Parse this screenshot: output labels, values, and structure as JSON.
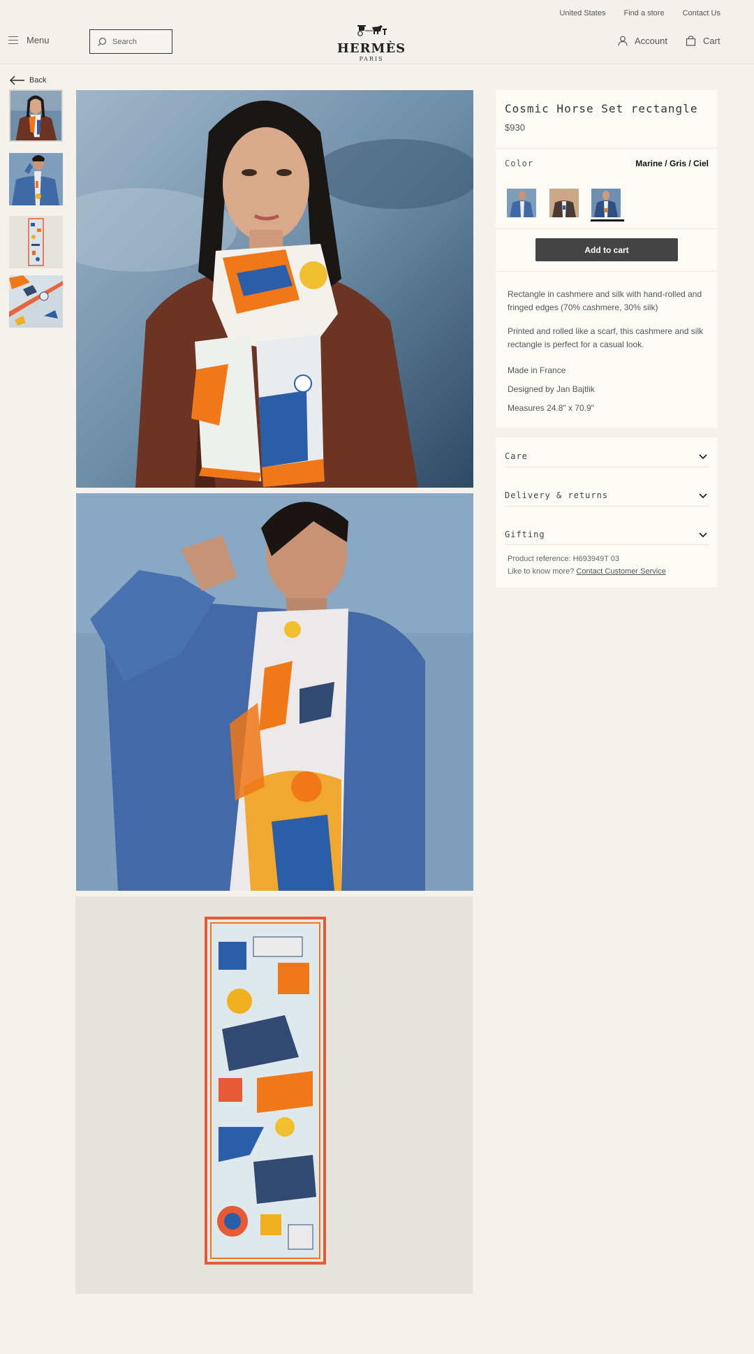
{
  "header": {
    "util_links": [
      "United States",
      "Find a store",
      "Contact Us"
    ],
    "menu_label": "Menu",
    "search_placeholder": "Search",
    "logo": {
      "brand": "HERMÈS",
      "city": "PARIS"
    },
    "account_label": "Account",
    "cart_label": "Cart"
  },
  "back_label": "Back",
  "gallery": {
    "thumbnails": [
      "model-woman-brown-jacket",
      "model-man-denim-shirt",
      "scarf-flat-lay",
      "scarf-detail"
    ],
    "images": [
      "woman-wearing-scarf",
      "man-wearing-scarf",
      "scarf-laid-flat"
    ]
  },
  "product": {
    "title": "Cosmic Horse Set rectangle",
    "price": "$930",
    "color_label": "Color",
    "color_value": "Marine / Gris / Ciel",
    "swatches": [
      "denim-blue",
      "brown-beige",
      "marine-selected"
    ],
    "add_to_cart": "Add to cart",
    "description": [
      "Rectangle in cashmere and silk with hand-rolled and fringed edges (70% cashmere, 30% silk)",
      "Printed and rolled like a scarf, this cashmere and silk rectangle is perfect for a casual look."
    ],
    "details": [
      "Made in France",
      "Designed by Jan Bajtlik",
      "Measures 24.8\" x 70.9\""
    ]
  },
  "accordion": {
    "items": [
      "Care",
      "Delivery & returns",
      "Gifting"
    ],
    "reference_label": "Product reference:",
    "reference_value": "H693949T 03",
    "more_text": "Like to know more?",
    "contact_link": "Contact Customer Service"
  },
  "colors": {
    "background": "#f5f1eb",
    "card": "#fdfbf6",
    "button": "#444444",
    "scarf_orange": "#f07818",
    "scarf_blue": "#2c5da8"
  }
}
